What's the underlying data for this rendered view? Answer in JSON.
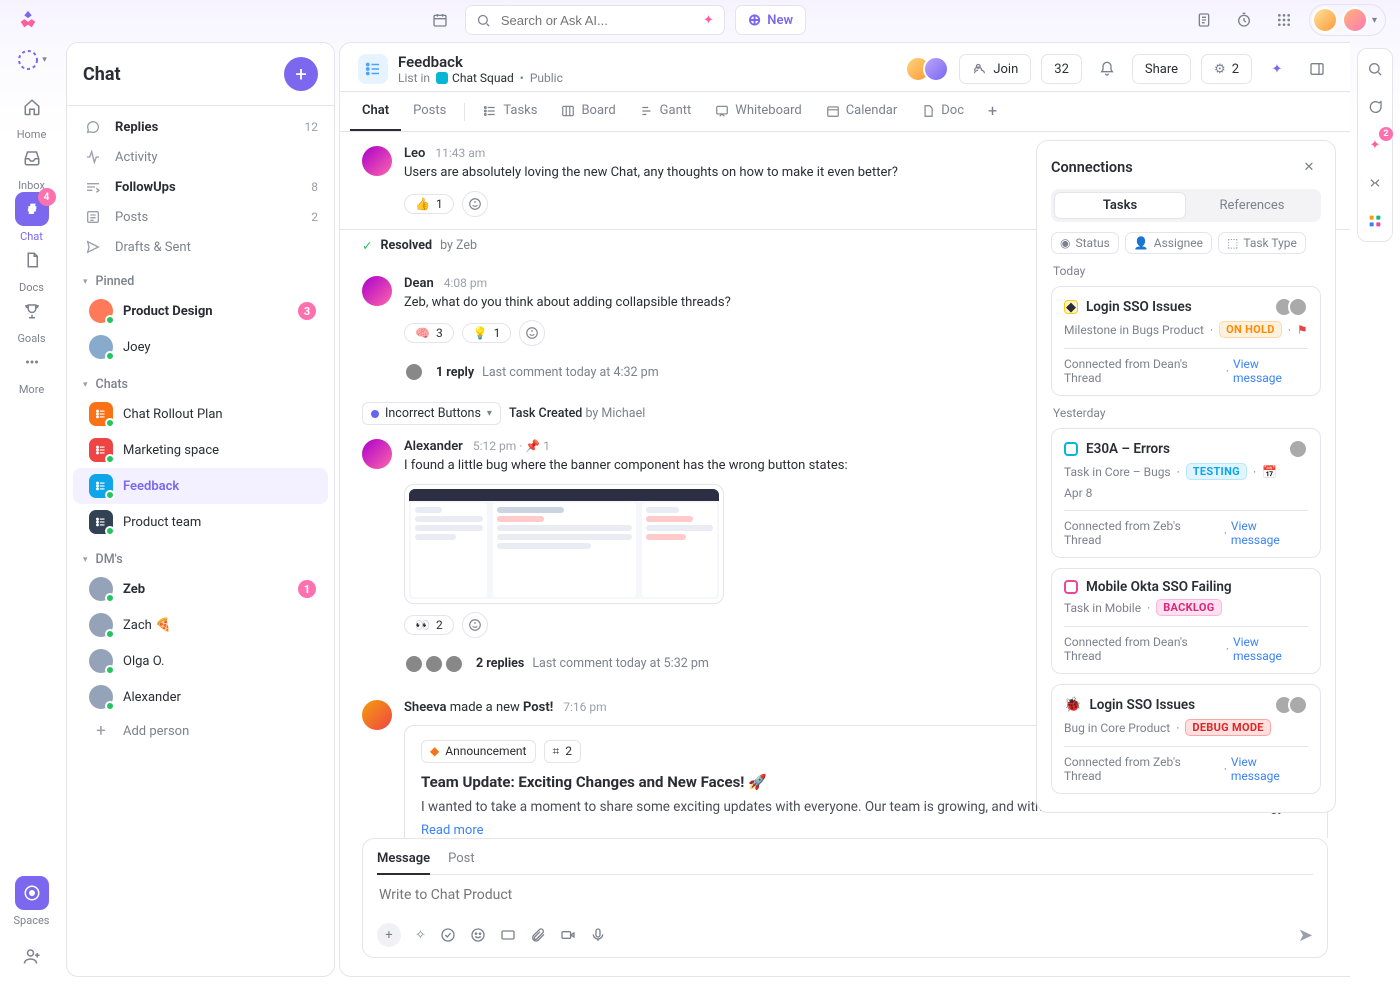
{
  "topbar": {
    "search_placeholder": "Search or Ask AI...",
    "new_label": "New"
  },
  "rail": [
    {
      "key": "home",
      "label": "Home"
    },
    {
      "key": "inbox",
      "label": "Inbox"
    },
    {
      "key": "chat",
      "label": "Chat",
      "badge": "4",
      "active": true
    },
    {
      "key": "docs",
      "label": "Docs"
    },
    {
      "key": "goals",
      "label": "Goals"
    },
    {
      "key": "more",
      "label": "More"
    }
  ],
  "rail_bottom": {
    "key": "spaces",
    "label": "Spaces"
  },
  "chat_sidebar": {
    "title": "Chat",
    "top": [
      {
        "key": "replies",
        "label": "Replies",
        "count": "12",
        "bold": true,
        "icon": "reply"
      },
      {
        "key": "activity",
        "label": "Activity",
        "icon": "pulse"
      },
      {
        "key": "followups",
        "label": "FollowUps",
        "count": "8",
        "bold": true,
        "icon": "followup"
      },
      {
        "key": "posts",
        "label": "Posts",
        "count": "2",
        "icon": "post"
      },
      {
        "key": "drafts",
        "label": "Drafts & Sent",
        "icon": "send"
      }
    ],
    "pinned_label": "Pinned",
    "pinned": [
      {
        "label": "Product Design",
        "badge": "3",
        "bold": true,
        "color": "#ff7a59"
      },
      {
        "label": "Joey",
        "color": "#8ac"
      }
    ],
    "chats_label": "Chats",
    "chats": [
      {
        "label": "Chat Rollout Plan",
        "list": true,
        "color": "#f97316"
      },
      {
        "label": "Marketing space",
        "list": true,
        "color": "#ef4444"
      },
      {
        "label": "Feedback",
        "list": true,
        "selected": true,
        "color": "#0ea5e9"
      },
      {
        "label": "Product team",
        "list": true,
        "color": "#334155"
      }
    ],
    "dms_label": "DM's",
    "dms": [
      {
        "label": "Zeb",
        "badge": "1",
        "bold": true
      },
      {
        "label": "Zach",
        "emoji": "🍕"
      },
      {
        "label": "Olga O."
      },
      {
        "label": "Alexander"
      }
    ],
    "add_person": "Add person"
  },
  "main": {
    "title": "Feedback",
    "crumb_prefix": "List in",
    "space": "Chat Squad",
    "visibility": "Public",
    "join": "Join",
    "member_count": "32",
    "share": "Share",
    "share_count": "2",
    "views": [
      {
        "key": "chat",
        "label": "Chat",
        "active": true
      },
      {
        "key": "posts",
        "label": "Posts"
      },
      {
        "_div": true
      },
      {
        "key": "tasks",
        "label": "Tasks",
        "icon": "list"
      },
      {
        "key": "board",
        "label": "Board",
        "icon": "board"
      },
      {
        "key": "gantt",
        "label": "Gantt",
        "icon": "gantt"
      },
      {
        "key": "whiteboard",
        "label": "Whiteboard",
        "icon": "wb"
      },
      {
        "key": "calendar",
        "label": "Calendar",
        "icon": "cal"
      },
      {
        "key": "doc",
        "label": "Doc",
        "icon": "doc"
      }
    ],
    "messages": [
      {
        "author": "Leo",
        "time": "11:43 am",
        "text": "Users are absolutely loving the new Chat, any thoughts on how to make it even better?",
        "reactions": [
          {
            "e": "👍",
            "n": "1"
          }
        ]
      },
      {
        "banner": {
          "kind": "resolved",
          "label": "Resolved",
          "by_prefix": "by",
          "by": "Zeb"
        }
      },
      {
        "author": "Dean",
        "time": "4:08 pm",
        "text": "Zeb, what do you think about adding collapsible threads?",
        "reactions": [
          {
            "e": "🧠",
            "n": "3"
          },
          {
            "e": "💡",
            "n": "1"
          }
        ],
        "thread": {
          "replies": "1 reply",
          "last": "Last comment today at 4:32 pm",
          "avatars": 1
        }
      },
      {
        "task_chip": {
          "title": "Incorrect Buttons",
          "status": "Task Created",
          "by_prefix": "by",
          "by": "Michael"
        }
      },
      {
        "author": "Alexander",
        "time": "5:12 pm",
        "pin": "1",
        "text": "I found a little bug where the banner component has the wrong button states:",
        "attachment": true,
        "reactions": [
          {
            "e": "👀",
            "n": "2"
          }
        ],
        "thread": {
          "replies": "2 replies",
          "last": "Last comment today at 5:32 pm",
          "avatars": 3
        }
      },
      {
        "post": {
          "author": "Sheeva",
          "action": " made a new ",
          "action_obj": "Post!",
          "time": "7:16 pm",
          "tag": "Announcement",
          "tag_count": "2",
          "title": "Team Update: Exciting Changes and New Faces! 🚀",
          "body": "I wanted to take a moment to share some exciting updates with everyone. Our team is growing, and with that comes new faces, and fresh energy!",
          "read_more": "Read more"
        }
      }
    ],
    "composer": {
      "tabs": [
        "Message",
        "Post"
      ],
      "placeholder": "Write to Chat Product"
    }
  },
  "connections": {
    "title": "Connections",
    "segments": [
      "Tasks",
      "References"
    ],
    "filters": [
      "Status",
      "Assignee",
      "Task Type"
    ],
    "groups": [
      {
        "label": "Today",
        "cards": [
          {
            "icon": "yellow",
            "title": "Login SSO Issues",
            "sub": "Milestone in Bugs Product",
            "status": {
              "text": "ON HOLD",
              "cls": "sc-onhold"
            },
            "flag": true,
            "avatars": 2,
            "foot": "Connected from Dean's Thread",
            "view": "View message"
          }
        ]
      },
      {
        "label": "Yesterday",
        "cards": [
          {
            "icon": "cyan",
            "title": "E30A – Errors",
            "sub": "Task in Core – Bugs",
            "status": {
              "text": "TESTING",
              "cls": "sc-testing"
            },
            "date": "Apr 8",
            "avatars": 1,
            "foot": "Connected from Zeb's Thread",
            "view": "View message"
          },
          {
            "icon": "pink",
            "title": "Mobile Okta SSO Failing",
            "sub": "Task in Mobile",
            "status": {
              "text": "BACKLOG",
              "cls": "sc-backlog"
            },
            "foot": "Connected from Dean's Thread",
            "view": "View message"
          },
          {
            "icon": "bug",
            "title": "Login SSO Issues",
            "sub": "Bug in Core Product",
            "status": {
              "text": "DEBUG MODE",
              "cls": "sc-debug"
            },
            "avatars": 2,
            "foot": "Connected from Zeb's Thread",
            "view": "View message"
          }
        ]
      }
    ]
  },
  "right_rail": {
    "badge": "2"
  }
}
